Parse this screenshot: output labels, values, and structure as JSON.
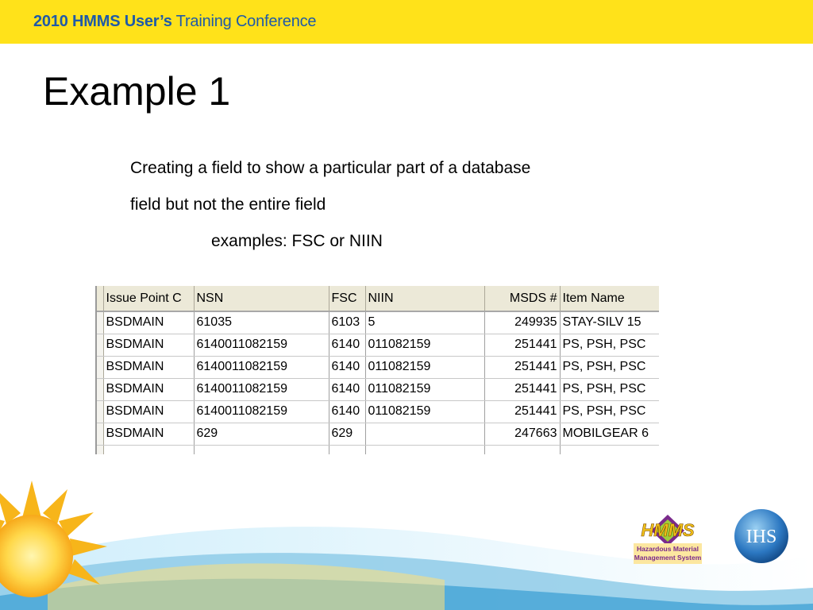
{
  "header": {
    "title_bold": "2010 HMMS User’s",
    "title_rest": " Training Conference"
  },
  "slide": {
    "title": "Example 1",
    "lines": [
      "Creating a field to show a particular  part of a database",
      "field but not the entire field",
      "examples: FSC or NIIN"
    ]
  },
  "grid": {
    "columns": [
      "Issue Point C",
      "NSN",
      "FSC",
      "NIIN",
      "MSDS #",
      "Item Name"
    ],
    "rows": [
      [
        "BSDMAIN",
        "61035",
        "6103",
        "5",
        "249935",
        "STAY-SILV 15"
      ],
      [
        "BSDMAIN",
        "6140011082159",
        "6140",
        "011082159",
        "251441",
        "PS, PSH, PSC"
      ],
      [
        "BSDMAIN",
        "6140011082159",
        "6140",
        "011082159",
        "251441",
        "PS, PSH, PSC"
      ],
      [
        "BSDMAIN",
        "6140011082159",
        "6140",
        "011082159",
        "251441",
        "PS, PSH, PSC"
      ],
      [
        "BSDMAIN",
        "6140011082159",
        "6140",
        "011082159",
        "251441",
        "PS, PSH, PSC"
      ],
      [
        "BSDMAIN",
        "629",
        "629",
        "",
        "247663",
        "MOBILGEAR 6"
      ]
    ]
  },
  "logos": {
    "hmms_mark": "HMMS",
    "hmms_line1": "Hazardous Material",
    "hmms_line2": "Management System",
    "ihs_mark": "IHS"
  },
  "colors": {
    "banner": "#ffe21a",
    "banner_text": "#1f5aa8",
    "sun": "#f7b51a",
    "wave_blue": "#8fcbe8"
  }
}
